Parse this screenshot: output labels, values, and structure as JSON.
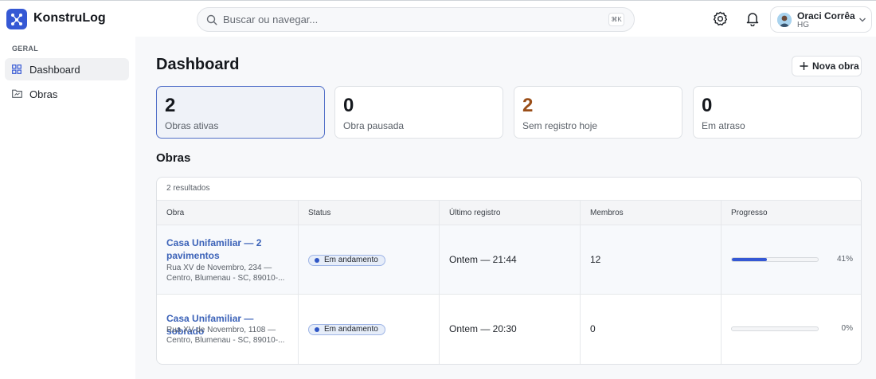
{
  "app": {
    "name": "KonstruLog",
    "brand_color": "#3558d4"
  },
  "search": {
    "placeholder": "Buscar ou navegar...",
    "shortcut": "⌘K"
  },
  "header": {
    "icons": [
      "gear-icon",
      "bell-icon"
    ]
  },
  "user": {
    "name": "Oraci Corrêa",
    "org": "HG"
  },
  "sidebar": {
    "section": "GERAL",
    "items": [
      {
        "label": "Dashboard",
        "icon": "grid-icon",
        "active": true
      },
      {
        "label": "Obras",
        "icon": "folder-icon",
        "active": false
      }
    ]
  },
  "page": {
    "title": "Dashboard",
    "new_button": "Nova obra"
  },
  "stats": [
    {
      "value": "2",
      "label": "Obras ativas",
      "active": true
    },
    {
      "value": "0",
      "label": "Obra pausada"
    },
    {
      "value": "2",
      "label": "Sem registro hoje",
      "color": "#9a4e18"
    },
    {
      "value": "0",
      "label": "Em atraso"
    }
  ],
  "obras": {
    "title": "Obras",
    "results": "2 resultados",
    "columns": [
      "Obra",
      "Status",
      "Último registro",
      "Membros",
      "Progresso"
    ],
    "rows": [
      {
        "name": "Casa Unifamiliar — 2 pavimentos",
        "address": "Rua XV de Novembro, 234 — Centro, Blumenau - SC, 89010-...",
        "status": "Em andamento",
        "last": "Ontem — 21:44",
        "members": "12",
        "progress": 0.41,
        "progress_label": "41%"
      },
      {
        "name": "Casa Unifamiliar — sobrado",
        "address": "Rua XV de Novembro, 1108 — Centro, Blumenau - SC, 89010-...",
        "status": "Em andamento",
        "last": "Ontem — 20:30",
        "members": "0",
        "progress": 0,
        "progress_label": "0%"
      }
    ]
  }
}
